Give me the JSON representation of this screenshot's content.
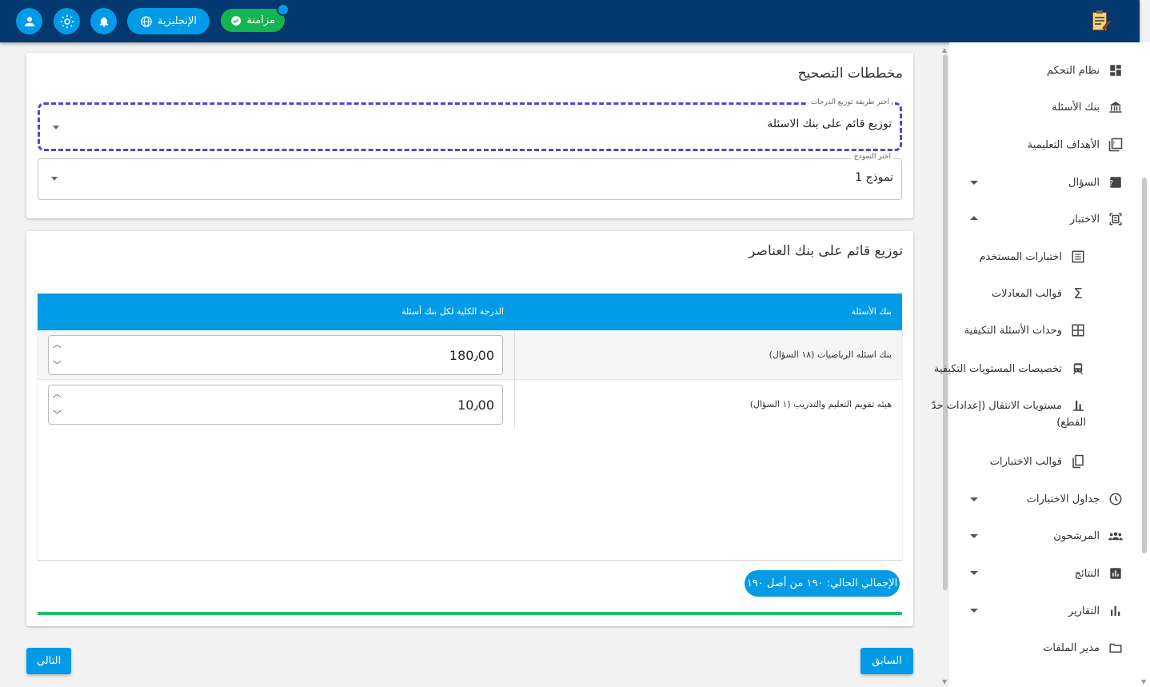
{
  "topbar": {
    "language_label": "الإنجليزية",
    "sync_label": "مزامنة",
    "icons": [
      "user-icon",
      "sun-icon",
      "bell-icon",
      "globe-icon",
      "check-circle-icon",
      "app-logo-icon"
    ]
  },
  "sidebar": {
    "items": [
      {
        "label": "نظام التحكم",
        "icon": "dashboard-icon"
      },
      {
        "label": "بنك الأسئلة",
        "icon": "bank-icon"
      },
      {
        "label": "الأهداف التعليمية",
        "icon": "objectives-icon"
      },
      {
        "label": "السؤال",
        "icon": "question-icon"
      },
      {
        "label": "الاختبار",
        "icon": "exam-icon"
      },
      {
        "label": "اختبارات المستخدم",
        "icon": "list-icon"
      },
      {
        "label": "قوالب المعادلات",
        "icon": "sigma-icon"
      },
      {
        "label": "وحدات الأسئلة التكيفية",
        "icon": "grid-icon"
      },
      {
        "label": "تخصيصات المستويات التكيفية",
        "icon": "train-icon"
      },
      {
        "label": "مستويات الانتقال (إعدادات حدّ",
        "label2": "القطع)",
        "icon": "bar-chart-icon"
      },
      {
        "label": "قوالب الاختبارات",
        "icon": "copy-icon"
      },
      {
        "label": "جداول الاختبارات",
        "icon": "clock-icon"
      },
      {
        "label": "المرشحون",
        "icon": "people-icon"
      },
      {
        "label": "النتائج",
        "icon": "results-icon"
      },
      {
        "label": "التقارير",
        "icon": "reports-icon"
      },
      {
        "label": "مدير الملفات",
        "icon": "folder-icon"
      }
    ]
  },
  "grading": {
    "title": "مخططات التصحيح",
    "method_label": "اختر طريقة توزيع الدرجات",
    "method_value": "توزيع قائم على بنك الاسئلة",
    "model_label": "اختر النموذج",
    "model_value": "نموذج 1"
  },
  "distribution": {
    "title": "توزيع قائم على بنك العناصر",
    "col_bank": "بنك الأسئلة",
    "col_total": "الدرجة الكلية لكل بنك أسئلة",
    "rows": [
      {
        "bank": "بنك اسئله الرياضيات (١٨ السؤال)",
        "score": "180٫00"
      },
      {
        "bank": "هيئه تقويم التعليم والتدريب (١ السؤال)",
        "score": "10٫00"
      }
    ],
    "total_label": "الإجمالي الحالي: ١٩٠ من أصل ١٩٠",
    "progress_percent": 100
  },
  "nav": {
    "next_label": "التالي",
    "prev_label": "السابق"
  },
  "colors": {
    "topbar": "#043870",
    "accent": "#039be5",
    "sync": "#14b44e",
    "progress": "#1fc06a",
    "focus": "#5b3fd6"
  }
}
